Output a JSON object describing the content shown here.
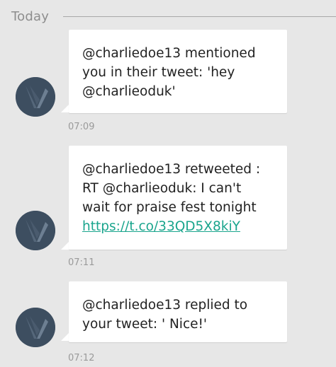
{
  "date_header": {
    "label": "Today"
  },
  "messages": [
    {
      "text": "@charliedoe13 mentioned\nyou in their tweet: 'hey\n@charlieoduk'",
      "link": "",
      "time": "07:09"
    },
    {
      "text": "@charliedoe13 retweeted :\nRT @charlieoduk: I can't\nwait for praise fest tonight",
      "link": "https://t.co/33QD5X8kiY",
      "time": "07:11"
    },
    {
      "text": "@charliedoe13 replied to\nyour tweet: ' Nice!'",
      "link": "",
      "time": "07:12"
    }
  ],
  "colors": {
    "background": "#e7e7e7",
    "bubble": "#ffffff",
    "avatar": "#3d4e60",
    "link": "#1aa58d"
  },
  "icons": {
    "avatar": "contact-avatar-icon"
  }
}
